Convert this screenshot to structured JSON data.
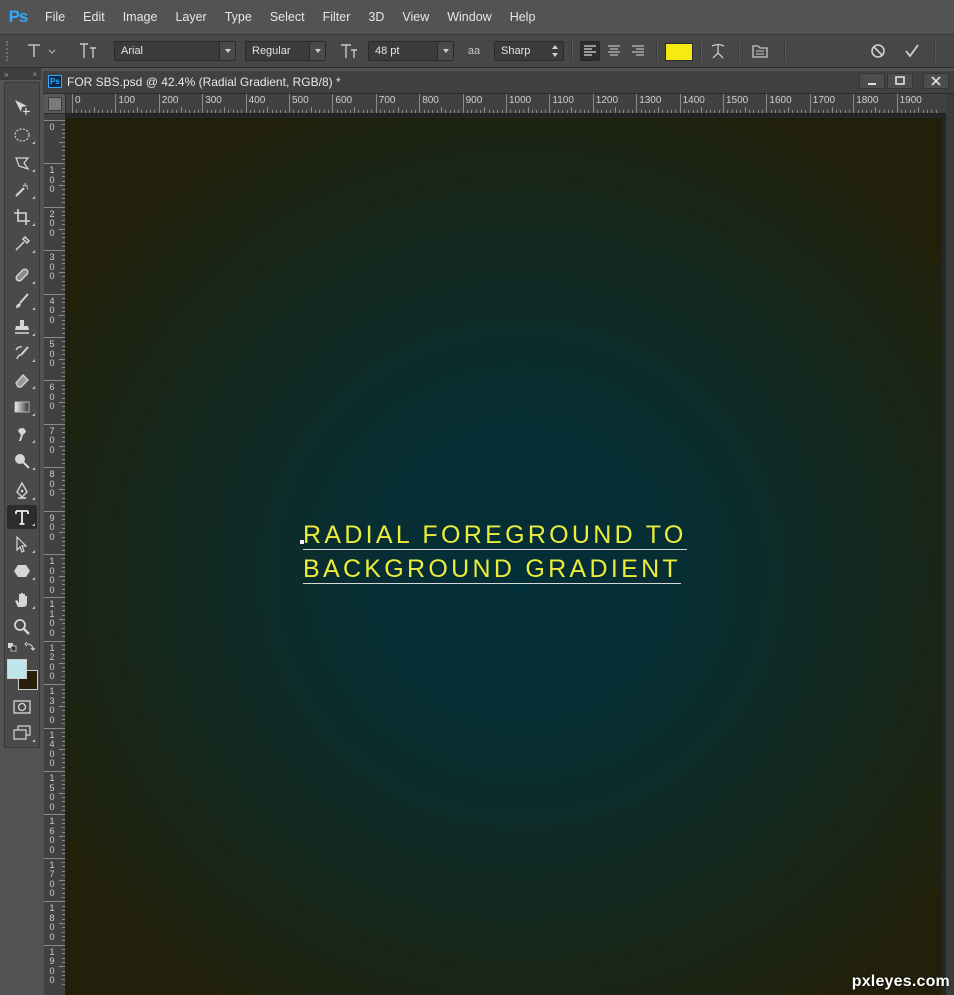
{
  "app": {
    "logo": "Ps"
  },
  "menu": [
    "File",
    "Edit",
    "Image",
    "Layer",
    "Type",
    "Select",
    "Filter",
    "3D",
    "View",
    "Window",
    "Help"
  ],
  "options_bar": {
    "tool_icon": "type-tool-icon",
    "font_family": "Arial",
    "font_style": "Regular",
    "font_size": "48 pt",
    "aa_label": "aa",
    "anti_alias": "Sharp",
    "text_color": "#f5ea14"
  },
  "panel_collapse": "»",
  "panel_close": "×",
  "document": {
    "tab_icon": "Ps",
    "title": "FOR SBS.psd @ 42.4% (Radial Gradient, RGB/8) *",
    "ruler_h": [
      "0",
      "100",
      "200",
      "300",
      "400",
      "500",
      "600",
      "700",
      "800",
      "900",
      "1000",
      "1100",
      "1200",
      "1300",
      "1400",
      "1500",
      "1600",
      "1700",
      "1800",
      "1900"
    ],
    "ruler_v": [
      "0",
      "100",
      "200",
      "300",
      "400",
      "500",
      "600",
      "700",
      "800",
      "900",
      "1000",
      "1100",
      "1200",
      "1300",
      "1400",
      "1500",
      "1600",
      "1700",
      "1800",
      "1900"
    ],
    "gradient": {
      "center": "#032f38",
      "edge": "#22200a"
    }
  },
  "canvas_text": {
    "line1": "RADIAL FOREGROUND TO",
    "line2": "BACKGROUND GRADIENT",
    "color": "#ecec3a"
  },
  "swatches": {
    "foreground": "#bfe6ea",
    "background": "#2a1d0a"
  },
  "watermark": "pxleyes.com"
}
